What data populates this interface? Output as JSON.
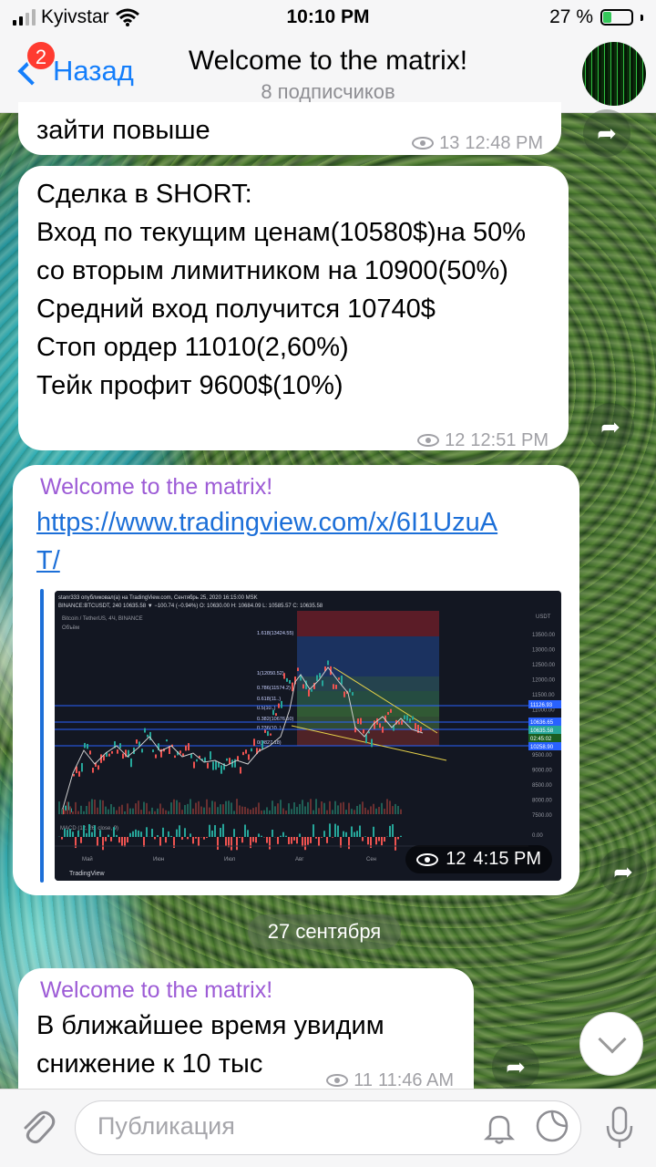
{
  "status_bar": {
    "carrier": "Kyivstar",
    "time": "10:10 PM",
    "battery": "27 %"
  },
  "header": {
    "back_label": "Назад",
    "unread_badge": "2",
    "title": "Welcome to the matrix!",
    "subtitle": "8 подписчиков"
  },
  "messages": [
    {
      "text": "зайти повыше",
      "views": "13",
      "time": "12:48 PM"
    },
    {
      "text": "Сделка в SHORT:\nВход по текущим ценам(10580$)на 50% со вторым лимитником на 10900(50%)\nСредний вход получится 10740$\nСтоп ордер 11010(2,60%)\nТейк профит 9600$(10%)",
      "views": "12",
      "time": "12:51 PM"
    },
    {
      "sender": "Welcome to the matrix!",
      "link": "https://www.tradingview.com/x/6I1UzuAT/",
      "image_caption": {
        "header": "stanr333 опубликовал(а) на TradingView.com, Сентябрь 25, 2020 16:15:00 MSK",
        "ticker": "BINANCE:BTCUSDT, 240  10635.58  ▼ −100.74 (−0.94%)  O: 10630.00  H: 10684.09  L: 10585.57  C: 10635.58",
        "pair": "Bitcoin / TetherUS, 4Ч, BINANCE",
        "volume": "Объём",
        "macd": "MACD (12, 26, close, 9)",
        "brand": "TradingView",
        "currency": "USDT",
        "months": [
          "Май",
          "Июн",
          "Июл",
          "Авг",
          "Сен"
        ],
        "price_ticks": [
          "13500.00",
          "13000.00",
          "12500.00",
          "12000.00",
          "11500.00",
          "11000.00",
          "10500.00",
          "10000.00",
          "9500.00",
          "9000.00",
          "8500.00",
          "8000.00",
          "7500.00",
          "0.00"
        ],
        "price_tags": [
          "11126.93",
          "10636.65",
          "10635.58",
          "02:45:02",
          "10258.90"
        ],
        "fib_levels": [
          "1.618(13424.55)",
          "1(12050.52)",
          "0.786(11574.2)",
          "0.618(11..)",
          "0.5(10..)",
          "0.382(10676.50)",
          "0.236(10..)",
          "0(9827.18)"
        ]
      },
      "views": "12",
      "time": "4:15 PM"
    },
    {
      "date_separator": "27 сентября"
    },
    {
      "sender": "Welcome to the matrix!",
      "text": "В ближайшее время увидим снижение к 10 тыс",
      "views": "11",
      "time": "11:46 AM"
    }
  ],
  "input_bar": {
    "placeholder": "Публикация"
  },
  "icons": [
    "signal-icon",
    "wifi-icon",
    "battery-icon",
    "back-chevron-icon",
    "eye-icon",
    "share-icon",
    "chevron-down-icon",
    "paperclip-icon",
    "bell-icon",
    "sticker-icon",
    "microphone-icon"
  ],
  "colors": {
    "accent": "#147efb",
    "sender": "#9d5cd6",
    "link": "#1c6fd8",
    "badge": "#ff3b30"
  }
}
